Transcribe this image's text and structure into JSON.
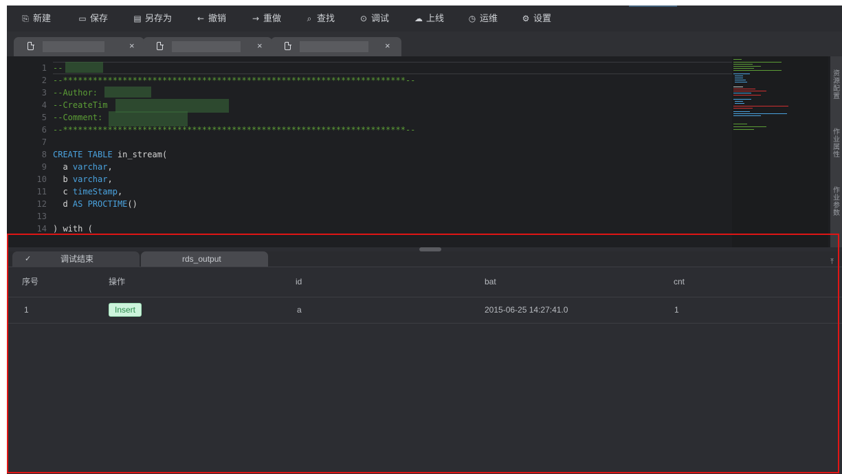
{
  "toolbar": {
    "items": [
      {
        "label": "新建",
        "icon": "new-file-icon"
      },
      {
        "label": "保存",
        "icon": "save-icon"
      },
      {
        "label": "另存为",
        "icon": "save-as-icon"
      },
      {
        "label": "撤销",
        "icon": "undo-icon"
      },
      {
        "label": "重做",
        "icon": "redo-icon"
      },
      {
        "label": "查找",
        "icon": "search-icon"
      },
      {
        "label": "调试",
        "icon": "debug-icon"
      },
      {
        "label": "上线",
        "icon": "publish-icon"
      },
      {
        "label": "运维",
        "icon": "ops-icon"
      },
      {
        "label": "设置",
        "icon": "settings-icon"
      }
    ]
  },
  "editor": {
    "line_numbers": [
      "1",
      "2",
      "3",
      "4",
      "5",
      "6",
      "7",
      "8",
      "9",
      "10",
      "11",
      "12",
      "13",
      "14"
    ],
    "lines": {
      "l1": "--",
      "l2": "--*********************************************************************--",
      "l3": "--Author:",
      "l4a": "--CreateTim",
      "l5": "--Comment:",
      "l6": "--*********************************************************************--",
      "l8_kw": "CREATE TABLE",
      "l8_rest": " in_stream(",
      "l9_col": "  a ",
      "l9_type": "varchar",
      "l9_end": ",",
      "l10_col": "  b ",
      "l10_type": "varchar",
      "l10_end": ",",
      "l11_col": "  c ",
      "l11_type": "timeStamp",
      "l11_end": ",",
      "l12_col": "  d ",
      "l12_as": "AS",
      "l12_fn": "PROCTIME",
      "l12_end": "()",
      "l14": ") with ("
    }
  },
  "side_panel": {
    "labels": [
      "资源配置",
      "作业属性",
      "作业参数"
    ]
  },
  "results": {
    "tabs": [
      {
        "label": "调试结束",
        "icon": "check-icon"
      },
      {
        "label": "rds_output"
      }
    ],
    "columns": [
      "序号",
      "操作",
      "id",
      "bat",
      "cnt"
    ],
    "rows": [
      {
        "index": "1",
        "op": "Insert",
        "id": "a",
        "bat": "2015-06-25 14:27:41.0",
        "cnt": "1"
      }
    ]
  },
  "colors": {
    "comment": "#5c9e36",
    "keyword": "#4aa3df",
    "insert_badge_bg": "#cdf3dc",
    "highlight": "#e01515"
  }
}
